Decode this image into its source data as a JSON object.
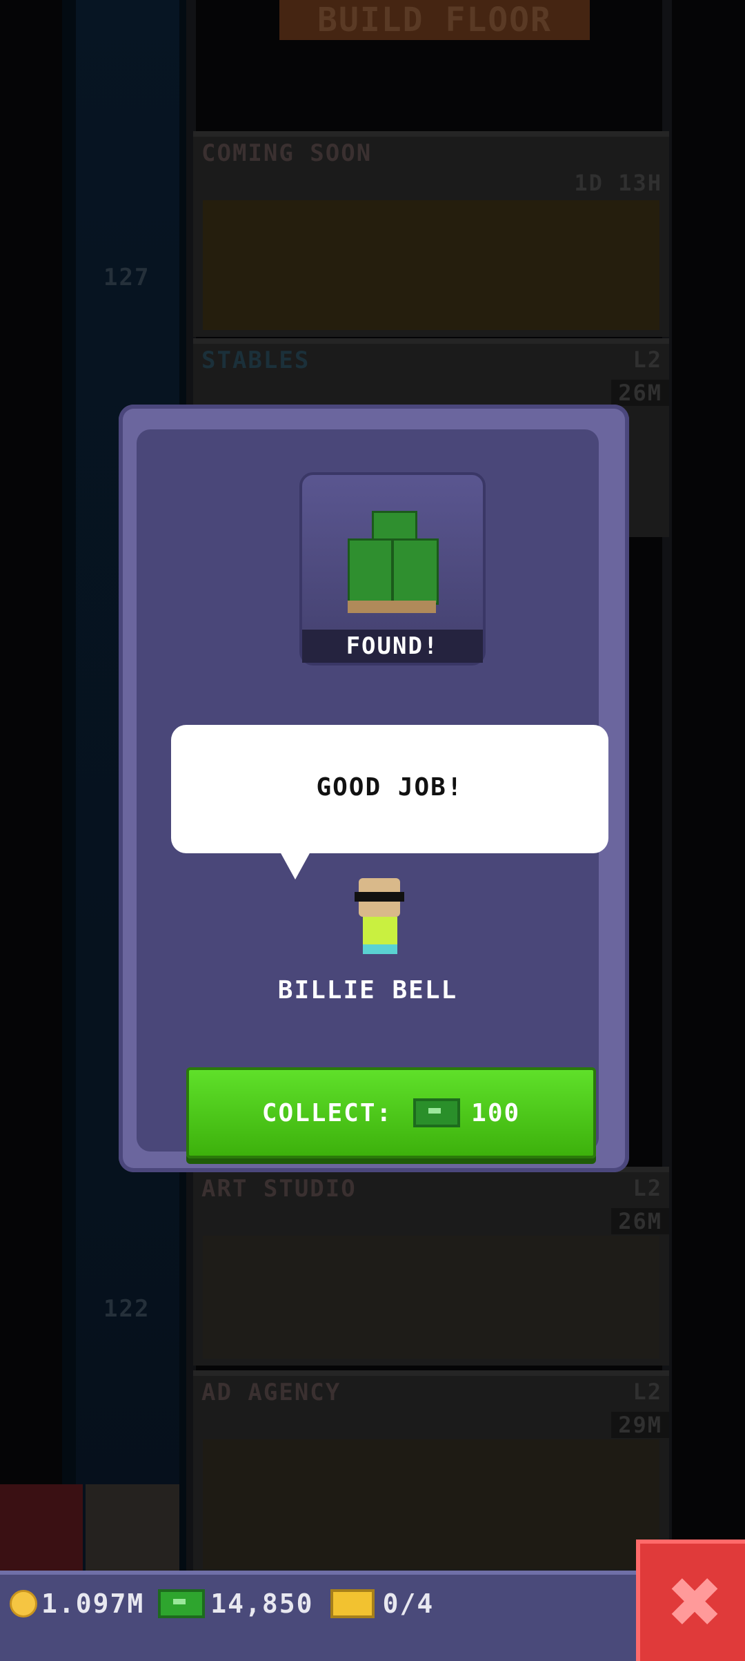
{
  "background": {
    "top_banner": "BUILD FLOOR",
    "floors": [
      {
        "name": "COMING SOON",
        "timer": "1D 13H",
        "number": "127"
      },
      {
        "name": "STABLES",
        "level": "L2",
        "income": "26M"
      },
      {
        "name": "ART STUDIO",
        "level": "L2",
        "income": "26M",
        "number": "122"
      },
      {
        "name": "AD AGENCY",
        "level": "L2",
        "income": "29M"
      }
    ]
  },
  "modal": {
    "found_label": "FOUND!",
    "speech": "GOOD JOB!",
    "character_name": "BILLIE BELL",
    "collect_label": "COLLECT:",
    "collect_amount": "100",
    "reward_icon": "bux-stack-icon"
  },
  "status_bar": {
    "coins": "1.097M",
    "bux": "14,850",
    "tickets": "0/4"
  },
  "colors": {
    "modal": "#6b669e",
    "collect": "#4fc81a",
    "close": "#e03a3a"
  }
}
